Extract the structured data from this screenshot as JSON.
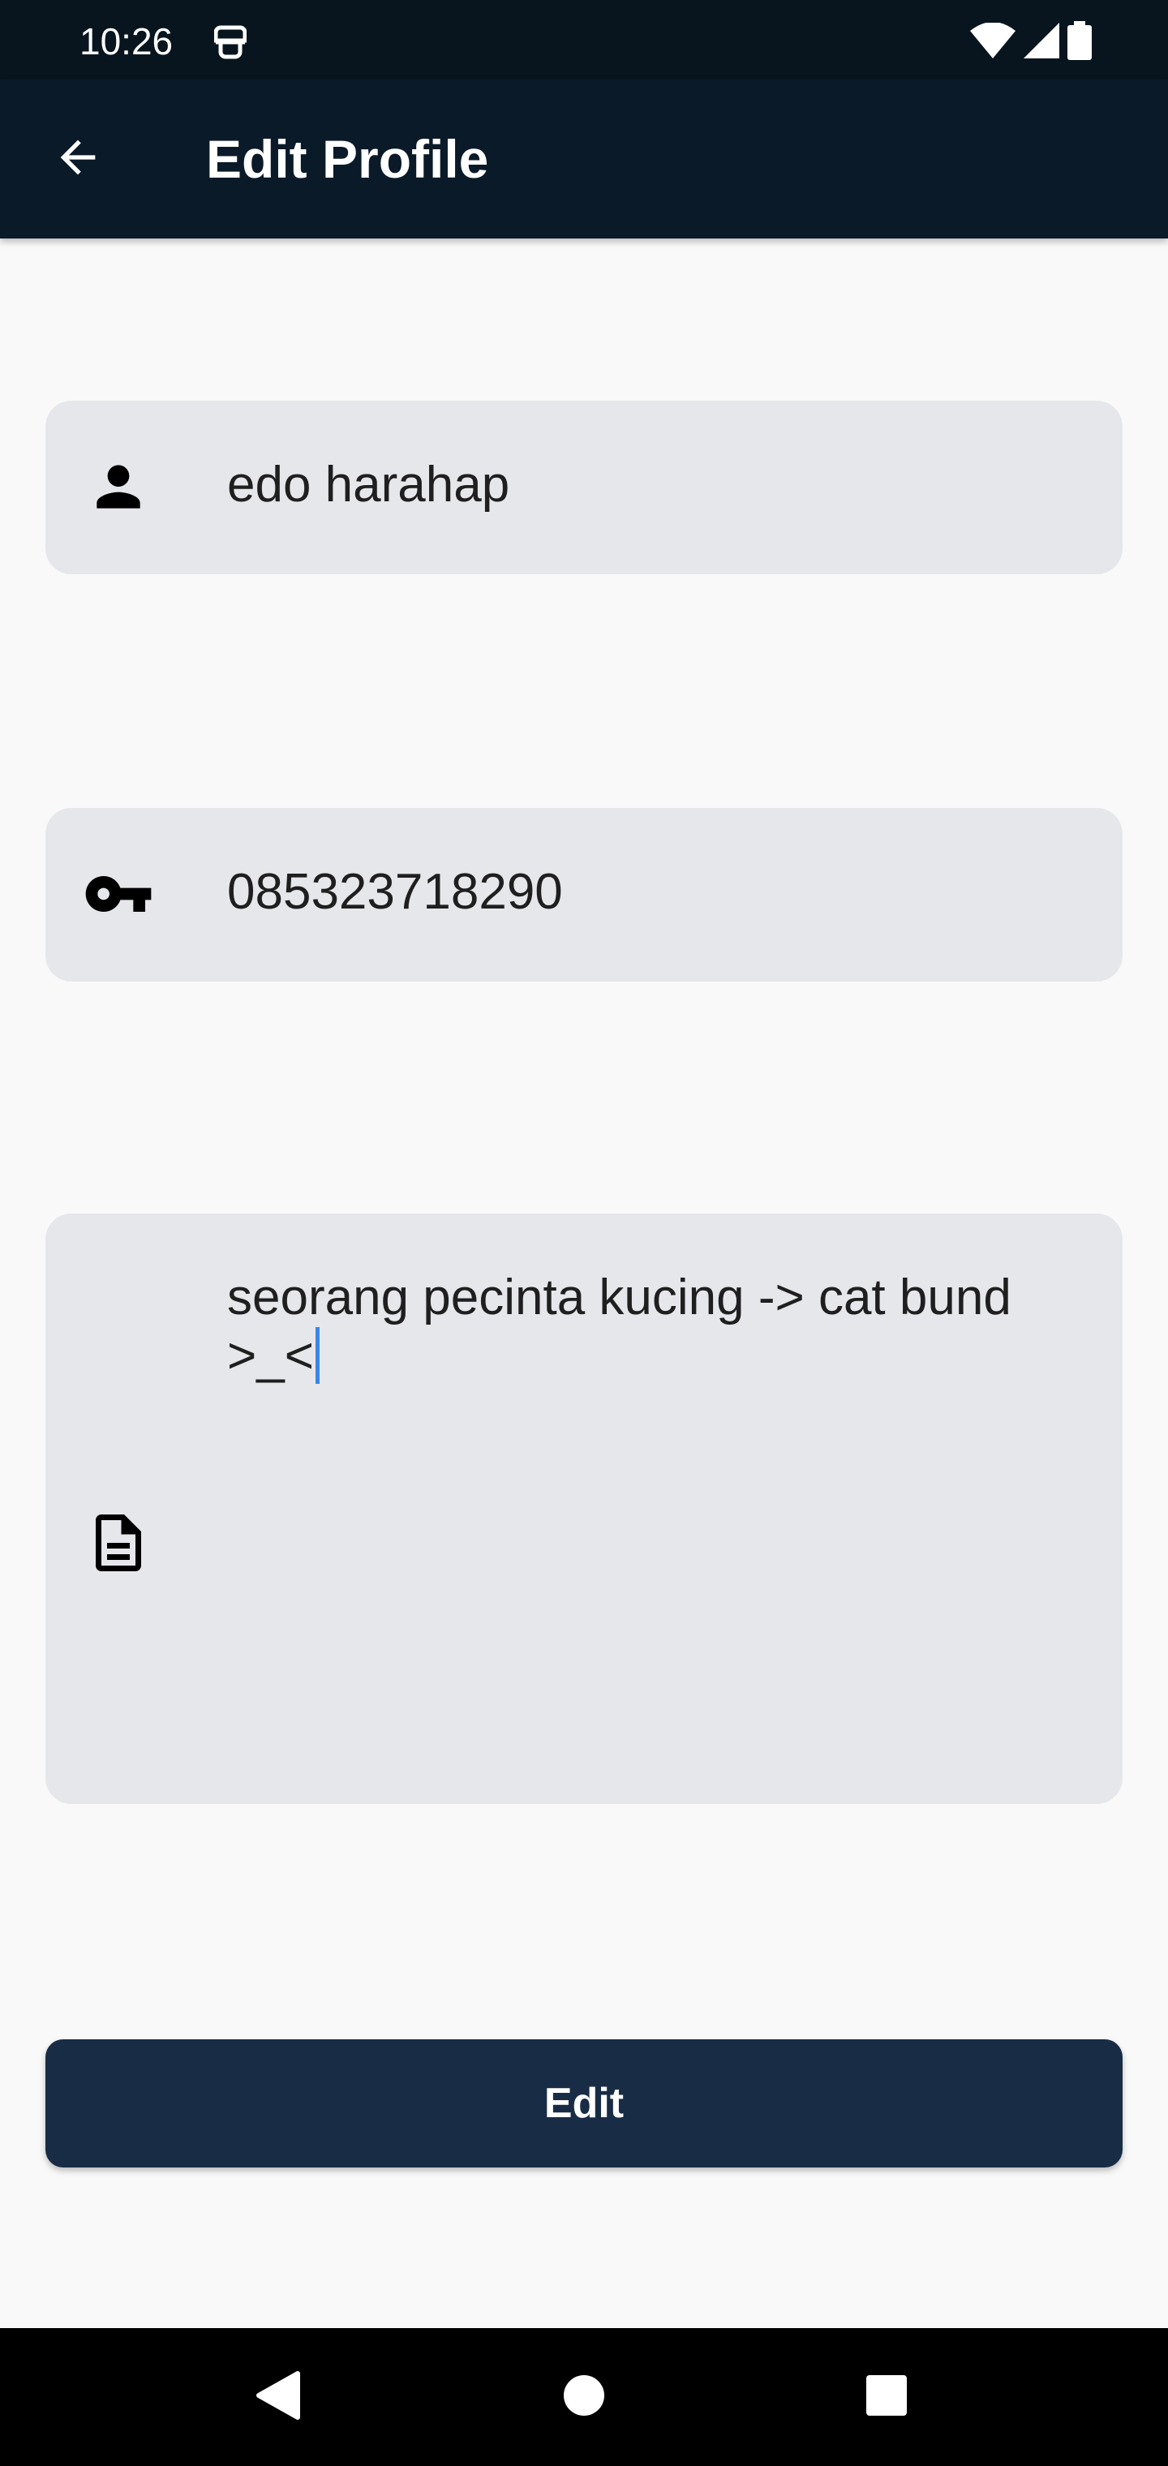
{
  "status_bar": {
    "time": "10:26",
    "icons": [
      "app-notification-icon",
      "wifi-icon",
      "cellular-signal-icon",
      "battery-icon"
    ]
  },
  "app_bar": {
    "title": "Edit Profile",
    "back_icon": "arrow-back-icon",
    "background": "#0b1a29"
  },
  "form": {
    "name": {
      "icon": "person-icon",
      "value": "edo harahap"
    },
    "phone": {
      "icon": "key-icon",
      "value": "085323718290"
    },
    "bio": {
      "icon": "document-icon",
      "value": "seorang pecinta kucing -> cat bund\n>_<"
    },
    "field_background": "#e6e7ea"
  },
  "edit_button": {
    "label": "Edit",
    "color": "#192c45"
  },
  "nav_bar": {
    "buttons": [
      "back-triangle-icon",
      "home-circle-icon",
      "recents-square-icon"
    ]
  },
  "colors": {
    "caret": "#3a86e8",
    "page_background": "#f9f9f9"
  }
}
